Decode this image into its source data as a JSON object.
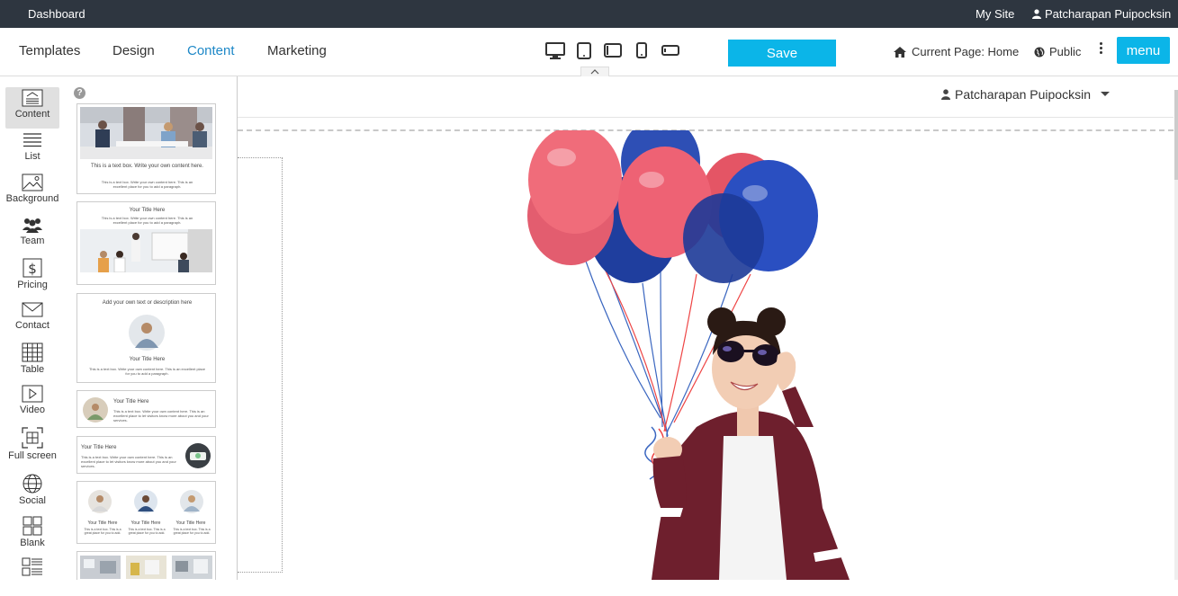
{
  "topbar": {
    "dashboard": "Dashboard",
    "my_site": "My Site",
    "user": "Patcharapan Puipocksin"
  },
  "toolbar": {
    "tabs": [
      "Templates",
      "Design",
      "Content",
      "Marketing"
    ],
    "active_tab": "Content",
    "devices": [
      "desktop-icon",
      "tablet-icon",
      "tablet-landscape-icon",
      "phone-icon",
      "phone-landscape-icon"
    ],
    "save": "Save",
    "current_page": "Current Page: Home",
    "public": "Public",
    "menu": "menu"
  },
  "sidebar": {
    "items": [
      {
        "label": "Content",
        "icon": "content-icon"
      },
      {
        "label": "List",
        "icon": "list-icon"
      },
      {
        "label": "Background",
        "icon": "image-icon"
      },
      {
        "label": "Team",
        "icon": "team-icon"
      },
      {
        "label": "Pricing",
        "icon": "dollar-icon"
      },
      {
        "label": "Contact",
        "icon": "envelope-icon"
      },
      {
        "label": "Table",
        "icon": "table-icon"
      },
      {
        "label": "Video",
        "icon": "play-icon"
      },
      {
        "label": "Full screen",
        "icon": "fullscreen-icon"
      },
      {
        "label": "Social",
        "icon": "globe-icon"
      },
      {
        "label": "Blank",
        "icon": "grid-icon"
      }
    ]
  },
  "panel": {
    "t1_text": "This is a text box. Write your own content here.",
    "t1_small": "This is a text box. Write your own content here. This is an excellent place for you to add a paragraph.",
    "t2_title": "Your Title Here",
    "t2_small": "This is a text box. Write your own content here. This is an excellent place for you to add a paragraph.",
    "t3_desc": "Add your own text or description here",
    "t3_title": "Your Title Here",
    "t3_small": "This is a text box. Write your own content here. This is an excellent place for you to add a paragraph.",
    "t4_title": "Your Title Here",
    "t4_small": "This is a text box. Write your own content here. This is an excellent place to let visitors know more about you and your services.",
    "t5_title": "Your Title Here",
    "t5_small": "This is a text box. Write your own content here. This is an excellent place to let visitors know more about you and your services.",
    "t6_title": "Your Title Here",
    "t6_small": "This is a text box. This is a great place for you to add."
  },
  "canvas": {
    "user": "Patcharapan Puipocksin"
  },
  "colors": {
    "accent": "#0bb5e8",
    "active_tab": "#1e88c7",
    "topbar": "#2e3640"
  }
}
